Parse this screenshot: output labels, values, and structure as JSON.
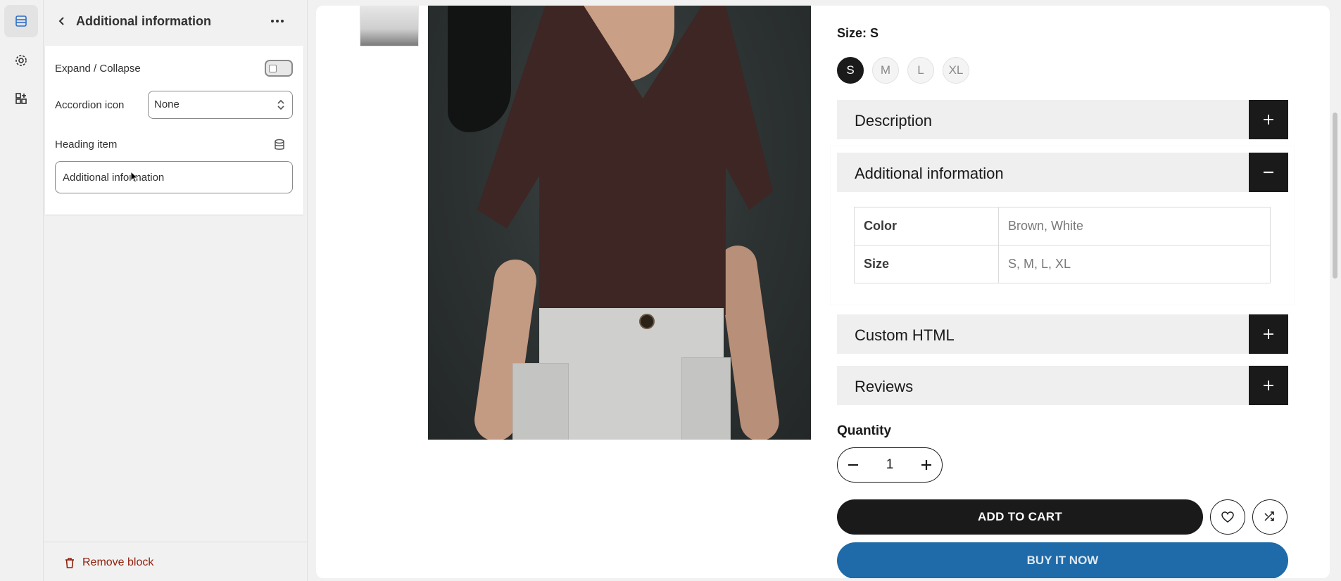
{
  "rail": {
    "items": [
      {
        "name": "sections",
        "active": true
      },
      {
        "name": "settings",
        "active": false
      },
      {
        "name": "apps",
        "active": false
      }
    ]
  },
  "panel": {
    "title": "Additional information",
    "expand_collapse_label": "Expand / Collapse",
    "expand_collapse_on": false,
    "accordion_icon_label": "Accordion icon",
    "accordion_icon_value": "None",
    "heading_item_label": "Heading item",
    "heading_item_value": "Additional information",
    "remove_block_label": "Remove block"
  },
  "product": {
    "size_label": "Size: S",
    "sizes": [
      "S",
      "M",
      "L",
      "XL"
    ],
    "selected_size": "S",
    "accordions": {
      "description": "Description",
      "additional_information": "Additional information",
      "custom_html": "Custom HTML",
      "reviews": "Reviews"
    },
    "attributes": [
      {
        "key": "Color",
        "value": "Brown, White"
      },
      {
        "key": "Size",
        "value": "S, M, L, XL"
      }
    ],
    "quantity_label": "Quantity",
    "quantity_value": "1",
    "add_to_cart_label": "ADD TO CART",
    "buy_it_now_label": "BUY IT NOW"
  },
  "colors": {
    "accent_dark": "#1a1a1a",
    "buy_now": "#1f6aa8",
    "remove": "#8e1f0b",
    "shirt": "#3d2623"
  }
}
